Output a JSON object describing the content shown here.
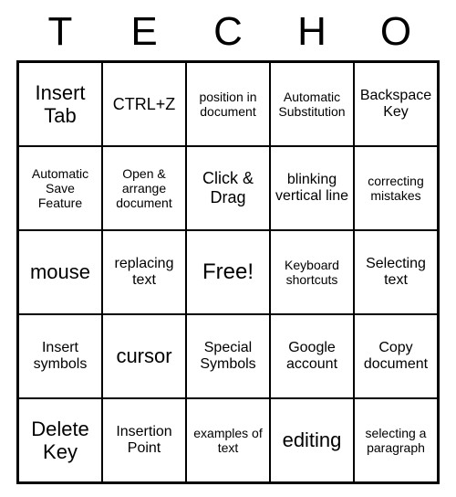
{
  "header": [
    "T",
    "E",
    "C",
    "H",
    "O"
  ],
  "cells": [
    {
      "text": "Insert Tab",
      "cls": "large"
    },
    {
      "text": "CTRL+Z",
      "cls": "med"
    },
    {
      "text": "position in document",
      "cls": "small"
    },
    {
      "text": "Automatic Substitution",
      "cls": "small"
    },
    {
      "text": "Backspace Key",
      "cls": ""
    },
    {
      "text": "Automatic Save Feature",
      "cls": "small"
    },
    {
      "text": "Open & arrange document",
      "cls": "small"
    },
    {
      "text": "Click & Drag",
      "cls": "med"
    },
    {
      "text": "blinking vertical line",
      "cls": ""
    },
    {
      "text": "correcting mistakes",
      "cls": "small"
    },
    {
      "text": "mouse",
      "cls": "large"
    },
    {
      "text": "replacing text",
      "cls": ""
    },
    {
      "text": "Free!",
      "cls": "free"
    },
    {
      "text": "Keyboard shortcuts",
      "cls": "small"
    },
    {
      "text": "Selecting text",
      "cls": ""
    },
    {
      "text": "Insert symbols",
      "cls": ""
    },
    {
      "text": "cursor",
      "cls": "large"
    },
    {
      "text": "Special Symbols",
      "cls": ""
    },
    {
      "text": "Google account",
      "cls": ""
    },
    {
      "text": "Copy document",
      "cls": ""
    },
    {
      "text": "Delete Key",
      "cls": "large"
    },
    {
      "text": "Insertion Point",
      "cls": ""
    },
    {
      "text": "examples of text",
      "cls": "small"
    },
    {
      "text": "editing",
      "cls": "large"
    },
    {
      "text": "selecting a paragraph",
      "cls": "small"
    }
  ]
}
